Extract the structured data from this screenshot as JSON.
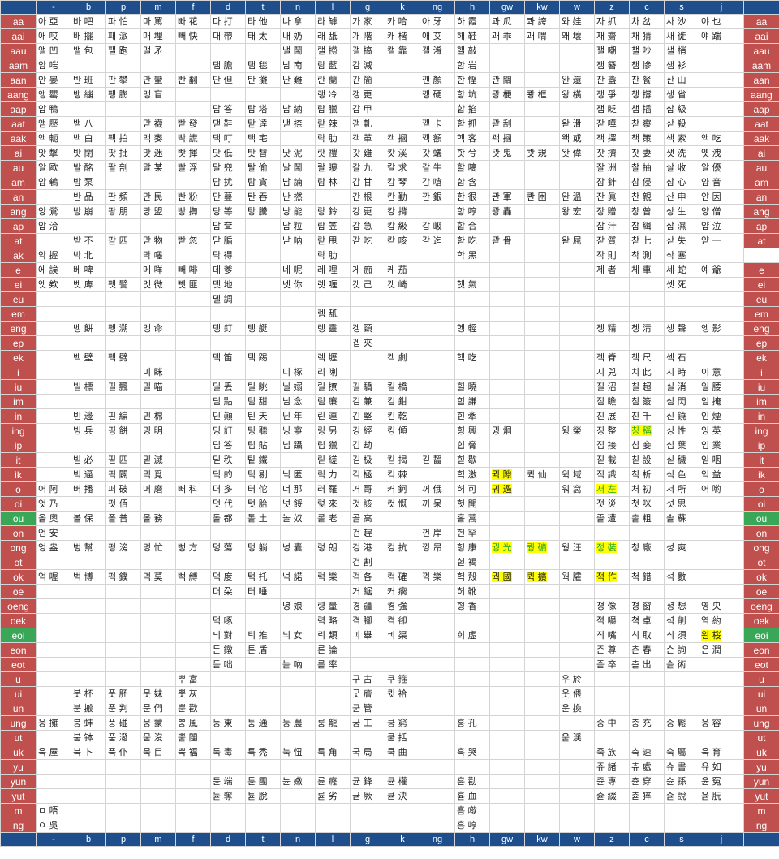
{
  "colors": {
    "header_bg": "#1f4e8c",
    "row_label_bg": "#c0504d",
    "row_label_green": "#3aa758",
    "highlight": "#ffff00"
  },
  "columns": [
    "-",
    "b",
    "p",
    "m",
    "f",
    "d",
    "t",
    "n",
    "l",
    "g",
    "k",
    "ng",
    "h",
    "gw",
    "kw",
    "w",
    "z",
    "c",
    "s",
    "j"
  ],
  "green_rows": [
    "ou",
    "eoi"
  ],
  "highlights": {
    "ing": {
      "17": "yellow-green"
    },
    "ik": {
      "13": "yellow"
    },
    "o": {
      "13": "yellow",
      "16": "yellow-green"
    },
    "ong": {
      "13": "yellow-green",
      "14": "yellow-green",
      "16": "yellow-green"
    },
    "ok": {
      "13": "yellow",
      "14": "yellow",
      "16": "yellow"
    },
    "eoi": {
      "19": "yellow"
    }
  },
  "rows": [
    {
      "label": "aa",
      "cells": [
        "아 亞",
        "바 吧",
        "파 怕",
        "마 罵",
        "빠 花",
        "다 打",
        "타 他",
        "나 拿",
        "라 罅",
        "가 家",
        "카 哈",
        "아 牙",
        "하 霞",
        "과 瓜",
        "콰 誇",
        "와 娃",
        "자 抓",
        "차 岔",
        "사 沙",
        "야 也"
      ]
    },
    {
      "label": "aai",
      "cells": [
        "애 哎",
        "배 擺",
        "패 派",
        "매 埋",
        "빼 快",
        "대 帶",
        "태 太",
        "내 奶",
        "래 舐",
        "개 階",
        "캐 楷",
        "애 艾",
        "해 鞋",
        "괘 乖",
        "괘 喟",
        "왜 壞",
        "재 齋",
        "채 猜",
        "새 徙",
        "얘 踹"
      ]
    },
    {
      "label": "aau",
      "cells": [
        "앨 凹",
        "밸 包",
        "팰 跑",
        "맬 矛",
        "",
        "",
        "",
        "낼 鬧",
        "랠 撈",
        "갤 搞",
        "캘 靠",
        "갤 淆",
        "핼 敲",
        "",
        "",
        "",
        "잴 嘲",
        "챌 吵",
        "샐 梢",
        ""
      ]
    },
    {
      "label": "aam",
      "cells": [
        "암 啱",
        "",
        "",
        "",
        "",
        "댐 膽",
        "탬 毯",
        "남 南",
        "람 藍",
        "감 減",
        "",
        "",
        "함 岩",
        "",
        "",
        "",
        "잼 簪",
        "챔 慘",
        "샘 衫",
        ""
      ]
    },
    {
      "label": "aan",
      "cells": [
        "안 晏",
        "반 班",
        "판 攀",
        "만 蠻",
        "빤 翻",
        "단 但",
        "탄 攤",
        "난 難",
        "란 蘭",
        "간 簡",
        "",
        "깬 顏",
        "한 悭",
        "관 關",
        "",
        "완 還",
        "잔 盞",
        "찬 餐",
        "산 山",
        ""
      ]
    },
    {
      "label": "aang",
      "cells": [
        "앵 罌",
        "뱅 繃",
        "팽 膨",
        "맹 盲",
        "",
        "",
        "",
        "",
        "랭 冷",
        "갱 更",
        "",
        "깽 硬",
        "항 坑",
        "광 梗",
        "쾅 框",
        "왕 橫",
        "쟁 爭",
        "챙 撐",
        "생 省",
        ""
      ]
    },
    {
      "label": "aap",
      "cells": [
        "압 鴨",
        "",
        "",
        "",
        "",
        "답 答",
        "탑 塔",
        "납 納",
        "랍 臘",
        "갑 甲",
        "",
        "",
        "합 掐",
        "",
        "",
        "",
        "잽 眨",
        "챕 插",
        "삽 級",
        ""
      ]
    },
    {
      "label": "aat",
      "cells": [
        "앧 壓",
        "밷 八",
        "",
        "맏 襪",
        "빧 發",
        "댇 鞋",
        "탇 達",
        "낻 捺",
        "랃 辣",
        "갣 軋",
        "",
        "깯 卡",
        "핟 抓",
        "괃 刮",
        "",
        "왇 滑",
        "잗 嘩",
        "찯 察",
        "삳 殺",
        ""
      ]
    },
    {
      "label": "aak",
      "cells": [
        "액 軛",
        "백 白",
        "팩 拍",
        "맥 麥",
        "빡 謊",
        "댁 叮",
        "택 宅",
        "",
        "락 肋",
        "객 革",
        "캑 摑",
        "깩 額",
        "핵 客",
        "괙 摑",
        "",
        "왝 或",
        "잭 擇",
        "책 策",
        "색 索",
        "액 吃"
      ]
    },
    {
      "label": "ai",
      "cells": [
        "앗 擊",
        "밧 閉",
        "팟 批",
        "맛 迷",
        "빳 揮",
        "닷 低",
        "탓 替",
        "낫 泥",
        "랏 禮",
        "갓 雞",
        "캇 溪",
        "갓 蟻",
        "핫 兮",
        "괏 鬼",
        "쾃 規",
        "왓 偉",
        "잣 擠",
        "찻 妻",
        "샛 洗",
        "얫 洩"
      ]
    },
    {
      "label": "au",
      "cells": [
        "알 歐",
        "발 酩",
        "팔 剖",
        "말 某",
        "빨 浮",
        "달 兜",
        "탈 偷",
        "날 鬧",
        "랄 瞜",
        "갈 九",
        "칼 求",
        "갈 牛",
        "할 嗃",
        "",
        "",
        "",
        "잘 洲",
        "찰 抽",
        "살 收",
        "알 優"
      ]
    },
    {
      "label": "am",
      "cells": [
        "암 鵪",
        "밤 泵",
        "",
        "",
        "",
        "담 扰",
        "탐 貪",
        "남 諵",
        "람 林",
        "감 甘",
        "캄 琴",
        "감 嗆",
        "함 含",
        "",
        "",
        "",
        "잠 針",
        "참 侵",
        "삼 心",
        "얌 音"
      ]
    },
    {
      "label": "an",
      "cells": [
        "",
        "반 品",
        "판 頻",
        "만 民",
        "빤 粉",
        "단 蔓",
        "탄 吞",
        "난 撚",
        "",
        "간 根",
        "칸 勤",
        "깐 銀",
        "한 很",
        "관 軍",
        "콴 困",
        "완 溫",
        "잔 眞",
        "찬 親",
        "산 申",
        "얀 因"
      ]
    },
    {
      "label": "ang",
      "cells": [
        "앙 鶯",
        "방 崩",
        "팡 朋",
        "망 盟",
        "빵 揈",
        "당 等",
        "탕 騰",
        "낭 能",
        "랑 鈴",
        "강 更",
        "캉 揹",
        "",
        "항 哼",
        "광 轟",
        "",
        "왕 宏",
        "장 贈",
        "창 曾",
        "상 生",
        "양 僧"
      ]
    },
    {
      "label": "ap",
      "cells": [
        "압 洽",
        "",
        "",
        "",
        "",
        "답 耷",
        "",
        "납 粒",
        "랍 笠",
        "갑 急",
        "캅 級",
        "갑 岋",
        "합 合",
        "",
        "",
        "",
        "잡 汁",
        "찹 緝",
        "삽 濕",
        "얍 泣"
      ]
    },
    {
      "label": "at",
      "cells": [
        "",
        "받 不",
        "팓 匹",
        "맏 物",
        "빧 忽",
        "닫 腯",
        "",
        "낟 呐",
        "랃 甩",
        "갇 吃",
        "칻 咳",
        "갇 迄",
        "핟 吃",
        "괃 骨",
        "",
        "왇 屈",
        "잗 質",
        "찯 七",
        "삳 失",
        "얃 一"
      ]
    },
    {
      "label": "ak",
      "cells": [
        "악 握",
        "박 北",
        "",
        "막 嚜",
        "",
        "닥 得",
        "",
        "",
        "락 肋",
        "",
        "",
        "",
        "학 黑",
        "",
        "",
        "",
        "작 則",
        "착 測",
        "삭 塞",
        "",
        ""
      ]
    },
    {
      "label": "e",
      "cells": [
        "에 誒",
        "베 啤",
        "",
        "메 咩",
        "빼 啡",
        "데 爹",
        "",
        "네 呢",
        "레 哩",
        "게 痂",
        "케 茄",
        "",
        "",
        "",
        "",
        "",
        "제 者",
        "체 車",
        "세 蛇",
        "예 爺"
      ]
    },
    {
      "label": "ei",
      "cells": [
        "엣 欸",
        "벳 庳",
        "펫 譬",
        "멧 微",
        "뻿 匪",
        "뎃 地",
        "",
        "넷 你",
        "렛 喱",
        "겟 己",
        "켓 崎",
        "",
        "헷 氣",
        "",
        "",
        "",
        "",
        "",
        "셋 死",
        ""
      ]
    },
    {
      "label": "eu",
      "cells": [
        "",
        "",
        "",
        "",
        "",
        "뎰 調",
        "",
        "",
        "",
        "",
        "",
        "",
        "",
        "",
        "",
        "",
        "",
        "",
        "",
        ""
      ]
    },
    {
      "label": "em",
      "cells": [
        "",
        "",
        "",
        "",
        "",
        "",
        "",
        "",
        "렘 舐",
        "",
        "",
        "",
        "",
        "",
        "",
        "",
        "",
        "",
        "",
        ""
      ]
    },
    {
      "label": "eng",
      "cells": [
        "",
        "벵 餅",
        "펭 溯",
        "멩 命",
        "",
        "뎅 釘",
        "텡 艇",
        "",
        "렝 靈",
        "겡 頸",
        "",
        "",
        "헹 輕",
        "",
        "",
        "",
        "젱 精",
        "쳉 淸",
        "셍 聲",
        "엥 影"
      ]
    },
    {
      "label": "ep",
      "cells": [
        "",
        "",
        "",
        "",
        "",
        "",
        "",
        "",
        "",
        "겝 夾",
        "",
        "",
        "",
        "",
        "",
        "",
        "",
        "",
        "",
        ""
      ]
    },
    {
      "label": "ek",
      "cells": [
        "",
        "벡 壁",
        "펙 劈",
        "",
        "",
        "덱 笛",
        "텍 踢",
        "",
        "렉 壢",
        "",
        "켁 劇",
        "",
        "헥 吃",
        "",
        "",
        "",
        "젝 脊",
        "첵 尺",
        "섹 石",
        ""
      ]
    },
    {
      "label": "i",
      "cells": [
        "",
        "",
        "",
        "미 眯",
        "",
        "",
        "",
        "니 椓",
        "리 唎",
        "",
        "",
        "",
        "",
        "",
        "",
        "",
        "지 兕",
        "치 此",
        "시 時",
        "이 意"
      ]
    },
    {
      "label": "iu",
      "cells": [
        "",
        "빌 標",
        "필 飄",
        "밀 喵",
        "",
        "딜 丢",
        "틸 眺",
        "닐 嫋",
        "릴 撩",
        "길 驕",
        "킬 橋",
        "",
        "힐 曉",
        "",
        "",
        "",
        "질 沼",
        "칠 超",
        "실 消",
        "일 腰"
      ]
    },
    {
      "label": "im",
      "cells": [
        "",
        "",
        "",
        "",
        "",
        "딤 點",
        "팀 甜",
        "님 念",
        "림 廉",
        "김 兼",
        "킴 鉗",
        "",
        "힘 謙",
        "",
        "",
        "",
        "짐 瞻",
        "침 簽",
        "심 閃",
        "임 掩"
      ]
    },
    {
      "label": "in",
      "cells": [
        "",
        "빈 邊",
        "핀 編",
        "민 棉",
        "",
        "딘 顚",
        "틴 天",
        "닌 年",
        "린 連",
        "긴 堅",
        "킨 乾",
        "",
        "힌 牽",
        "",
        "",
        "",
        "진 展",
        "친 千",
        "신 鐃",
        "인 煙"
      ]
    },
    {
      "label": "ing",
      "cells": [
        "",
        "빙 兵",
        "핑 餅",
        "밍 明",
        "",
        "딩 訂",
        "팅 聽",
        "닝 寧",
        "링 另",
        "깅 經",
        "킹 傾",
        "",
        "힝 興",
        "귕 炯",
        "",
        "윙 榮",
        "징 整",
        "칭 稱",
        "싱 性",
        "잉 英"
      ]
    },
    {
      "label": "ip",
      "cells": [
        "",
        "",
        "",
        "",
        "",
        "딥 答",
        "팁 貼",
        "닙 躡",
        "립 獵",
        "깁 劫",
        "",
        "",
        "힙 脅",
        "",
        "",
        "",
        "집 接",
        "칩 妾",
        "십 葉",
        "입 業"
      ]
    },
    {
      "label": "it",
      "cells": [
        "",
        "빋 必",
        "핃 匹",
        "믿 滅",
        "",
        "딛 秩",
        "팉 鐵",
        "",
        "릳 縒",
        "긷 极",
        "킫 揭",
        "긷 齧",
        "힏 歇",
        "",
        "",
        "",
        "짇 截",
        "칟 設",
        "싣 穢",
        "읻 咽"
      ]
    },
    {
      "label": "ik",
      "cells": [
        "",
        "빅 逼",
        "픽 闢",
        "믹 覓",
        "",
        "딕 的",
        "틱 剔",
        "닉 匿",
        "릭 力",
        "긱 極",
        "킥 棘",
        "",
        "힉 激",
        "귁 隙",
        "퀵 仙",
        "윅 域",
        "직 識",
        "칙 析",
        "식 色",
        "익 益"
      ]
    },
    {
      "label": "o",
      "cells": [
        "어 阿",
        "버 播",
        "퍼 破",
        "머 磨",
        "뻐 科",
        "더 多",
        "터 佗",
        "너 那",
        "러 羅",
        "거 哥",
        "커 鈳",
        "꺼 俄",
        "허 可",
        "궈 過",
        "",
        "워 窩",
        "저 左",
        "처 初",
        "서 所",
        "어 喲"
      ]
    },
    {
      "label": "oi",
      "cells": [
        "엇 乃",
        "",
        "펏 佰",
        "",
        "",
        "덧 代",
        "텃 胎",
        "넛 餒",
        "렂 來",
        "것 該",
        "컷 慨",
        "꺼 呆",
        "헛 開",
        "",
        "",
        "",
        "젓 災",
        "첫 咪",
        "섯 思",
        ""
      ]
    },
    {
      "label": "ou",
      "cells": [
        "올 奧",
        "볼 保",
        "폴 普",
        "몰 務",
        "",
        "돌 都",
        "톨 土",
        "놀 奴",
        "롤 老",
        "골 高",
        "",
        "",
        "홀 蒿",
        "",
        "",
        "",
        "졸 遭",
        "촐 粗",
        "솔 蘇",
        ""
      ]
    },
    {
      "label": "on",
      "cells": [
        "언 安",
        "",
        "",
        "",
        "",
        "",
        "",
        "",
        "",
        "건 趕",
        "",
        "껀 岸",
        "헌 罕",
        "",
        "",
        "",
        "",
        "",
        "",
        ""
      ]
    },
    {
      "label": "ong",
      "cells": [
        "엉 盎",
        "벙 幫",
        "펑 滂",
        "멍 忙",
        "뻥 方",
        "덩 蕩",
        "텅 躺",
        "넝 囊",
        "렁 朗",
        "겅 港",
        "컹 抗",
        "껑 昂",
        "헝 康",
        "궝 光",
        "퀑 礦",
        "웡 汪",
        "정 裝",
        "청 廠",
        "성 爽",
        ""
      ]
    },
    {
      "label": "ot",
      "cells": [
        "",
        "",
        "",
        "",
        "",
        "",
        "",
        "",
        "",
        "걷 割",
        "",
        "",
        "헏 褐",
        "",
        "",
        "",
        "",
        "",
        "",
        ""
      ]
    },
    {
      "label": "ok",
      "cells": [
        "억 喔",
        "벅 博",
        "퍽 鏷",
        "먹 莫",
        "뻑 縛",
        "덕 度",
        "턱 托",
        "넉 諾",
        "럭 樂",
        "걱 各",
        "컥 確",
        "꺽 樂",
        "헉 殼",
        "궉 國",
        "퀵 擴",
        "웍 臛",
        "적 作",
        "척 錯",
        "석 數",
        ""
      ]
    },
    {
      "label": "oe",
      "cells": [
        "",
        "",
        "",
        "",
        "",
        "더 朶",
        "터 唾",
        "",
        "",
        "거 鋸",
        "커 瘸",
        "",
        "허 靴",
        "",
        "",
        "",
        "",
        "",
        "",
        ""
      ]
    },
    {
      "label": "oeng",
      "cells": [
        "",
        "",
        "",
        "",
        "",
        "",
        "",
        "녕 娘",
        "령 量",
        "경 疆",
        "켱 強",
        "",
        "형 香",
        "",
        "",
        "",
        "졍 像",
        "쳥 窗",
        "셩 想",
        "영 央"
      ]
    },
    {
      "label": "oek",
      "cells": [
        "",
        "",
        "",
        "",
        "",
        "덕 啄",
        "",
        "",
        "력 略",
        "격 腳",
        "켝 卻",
        "",
        "",
        "",
        "",
        "",
        "젹 嚼",
        "쳑 卓",
        "셕 削",
        "역 約"
      ]
    },
    {
      "label": "eoi",
      "cells": [
        "",
        "",
        "",
        "",
        "",
        "듸 對",
        "틔 推",
        "늬 女",
        "릐 類",
        "긔 舉",
        "킈 渠",
        "",
        "희 虛",
        "",
        "",
        "",
        "즤 嘴",
        "츼 取",
        "싀 須",
        "읜 桜"
      ]
    },
    {
      "label": "eon",
      "cells": [
        "",
        "",
        "",
        "",
        "",
        "든 鐓",
        "튼 盾",
        "",
        "른 論",
        "",
        "",
        "",
        "",
        "",
        "",
        "",
        "즌 尊",
        "츤 春",
        "슨 詢",
        "은 潤"
      ]
    },
    {
      "label": "eot",
      "cells": [
        "",
        "",
        "",
        "",
        "",
        "듣 咄",
        "",
        "늗 吶",
        "륻 率",
        "",
        "",
        "",
        "",
        "",
        "",
        "",
        "즏 卒",
        "츧 出",
        "슫 術",
        ""
      ]
    },
    {
      "label": "u",
      "cells": [
        "",
        "",
        "",
        "",
        "뿌 富",
        "",
        "",
        "",
        "",
        "구 古",
        "쿠 箍",
        "",
        "",
        "",
        "",
        "우 於",
        "",
        "",
        "",
        ""
      ]
    },
    {
      "label": "ui",
      "cells": [
        "",
        "붓 杯",
        "풋 胚",
        "뭇 妹",
        "뿟 灰",
        "",
        "",
        "",
        "",
        "굿 癐",
        "큇 袷",
        "",
        "",
        "",
        "",
        "웃 偎",
        "",
        "",
        "",
        ""
      ]
    },
    {
      "label": "un",
      "cells": [
        "",
        "분 搬",
        "푼 判",
        "문 們",
        "뿐 歡",
        "",
        "",
        "",
        "",
        "군 管",
        "",
        "",
        "",
        "",
        "",
        "운 換",
        "",
        "",
        "",
        ""
      ]
    },
    {
      "label": "ung",
      "cells": [
        "웅 擁",
        "붕 蚌",
        "풍 碰",
        "뭉 蒙",
        "뿡 風",
        "둥 東",
        "퉁 通",
        "눙 農",
        "룽 龍",
        "궁 工",
        "쿵 窮",
        "",
        "훙 孔",
        "",
        "",
        "",
        "중 中",
        "충 充",
        "숭 鬆",
        "웅 容"
      ]
    },
    {
      "label": "ut",
      "cells": [
        "",
        "붇 钵",
        "푿 潑",
        "묻 沒",
        "뿓 闊",
        "",
        "",
        "",
        "",
        "",
        "쿧 括",
        "",
        "",
        "",
        "",
        "욷 渓",
        "",
        "",
        "",
        ""
      ]
    },
    {
      "label": "uk",
      "cells": [
        "욱 屋",
        "북 卜",
        "푹 仆",
        "묵 目",
        "뿍 福",
        "둑 毒",
        "툭 禿",
        "눅 忸",
        "룩 角",
        "국 局",
        "쿡 曲",
        "",
        "훅 哭",
        "",
        "",
        "",
        "죽 族",
        "축 速",
        "숙 屬",
        "욱 育"
      ]
    },
    {
      "label": "yu",
      "cells": [
        "",
        "",
        "",
        "",
        "",
        "",
        "",
        "",
        "",
        "",
        "",
        "",
        "",
        "",
        "",
        "",
        "쥬 諸",
        "츄 處",
        "슈 書",
        "유 如"
      ]
    },
    {
      "label": "yun",
      "cells": [
        "",
        "",
        "",
        "",
        "",
        "듄 端",
        "튠 團",
        "뉸 嫩",
        "륜 癃",
        "균 鋒",
        "큔 權",
        "",
        "휸 勸",
        "",
        "",
        "",
        "쥰 專",
        "츈 穿",
        "슌 孫",
        "윤 冤"
      ]
    },
    {
      "label": "yut",
      "cells": [
        "",
        "",
        "",
        "",
        "",
        "듇 奪",
        "튣 脫",
        "",
        "륟 劣",
        "귣 厥",
        "큗 決",
        "",
        "휻 血",
        "",
        "",
        "",
        "쥳 綴",
        "츋 猝",
        "슏 說",
        "윧 朊"
      ]
    },
    {
      "label": "m",
      "cells": [
        "ㅁ 唔",
        "",
        "",
        "",
        "",
        "",
        "",
        "",
        "",
        "",
        "",
        "",
        "흠 噷",
        "",
        "",
        "",
        "",
        "",
        "",
        ""
      ]
    },
    {
      "label": "ng",
      "cells": [
        "ㅇ 吳",
        "",
        "",
        "",
        "",
        "",
        "",
        "",
        "",
        "",
        "",
        "",
        "흥 哼",
        "",
        "",
        "",
        "",
        "",
        "",
        ""
      ]
    }
  ]
}
